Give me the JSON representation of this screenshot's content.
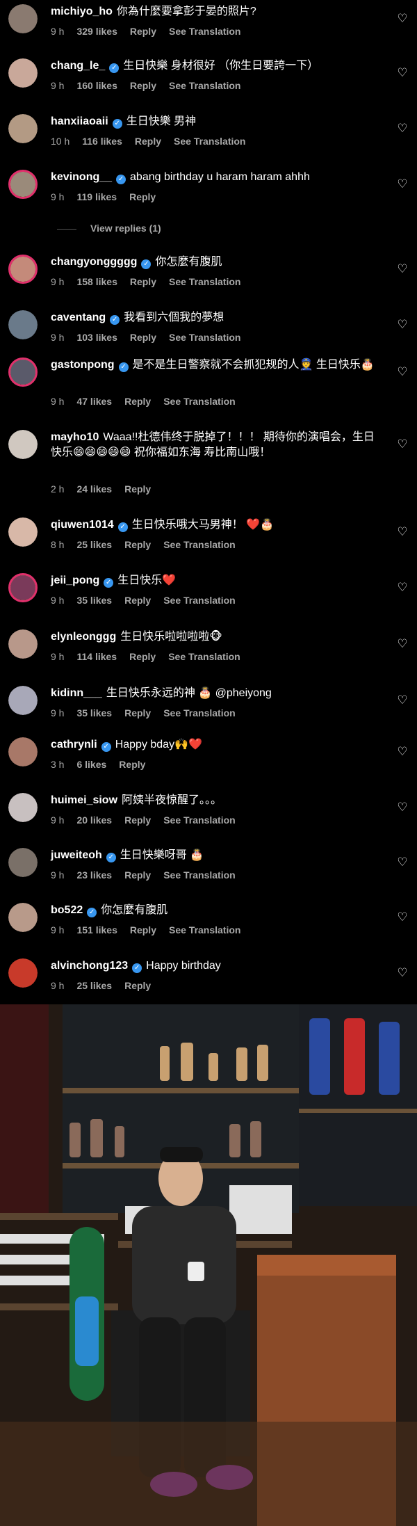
{
  "comments": [
    {
      "username": "michiyo_ho",
      "verified": false,
      "text": "你為什麼要拿彭于晏的照片?",
      "time": "9 h",
      "likes": "329 likes",
      "reply": "Reply",
      "translation": "See Translation",
      "avatar_color": "#8a7a70",
      "ring": false
    },
    {
      "username": "chang_le_",
      "verified": true,
      "text": "生日快樂 身材很好 （你生日要誇一下）",
      "time": "9 h",
      "likes": "160 likes",
      "reply": "Reply",
      "translation": "See Translation",
      "avatar_color": "#c9a89a",
      "ring": false
    },
    {
      "username": "hanxiiaoaii",
      "verified": true,
      "text": "生日快樂 男神",
      "time": "10 h",
      "likes": "116 likes",
      "reply": "Reply",
      "translation": "See Translation",
      "avatar_color": "#b39a84",
      "ring": false
    },
    {
      "username": "kevinong__",
      "verified": true,
      "text": "abang birthday u haram haram ahhh",
      "time": "9 h",
      "likes": "119 likes",
      "reply": "Reply",
      "translation": "",
      "avatar_color": "#9a8a7a",
      "ring": true
    },
    {
      "username": "changyonggggg",
      "verified": true,
      "text": "你怎麼有腹肌",
      "time": "9 h",
      "likes": "158 likes",
      "reply": "Reply",
      "translation": "See Translation",
      "avatar_color": "#c48a7a",
      "ring": true
    },
    {
      "username": "caventang",
      "verified": true,
      "text": "我看到六個我的夢想",
      "time": "9 h",
      "likes": "103 likes",
      "reply": "Reply",
      "translation": "See Translation",
      "avatar_color": "#6a7a8a",
      "ring": false
    },
    {
      "username": "gastonpong",
      "verified": true,
      "text": "是不是生日警察就不会抓犯规的人👮 生日快乐🎂",
      "time": "9 h",
      "likes": "47 likes",
      "reply": "Reply",
      "translation": "See Translation",
      "avatar_color": "#5a5a6a",
      "ring": true
    },
    {
      "username": "mayho10",
      "verified": false,
      "text": "Waaa!!杜德伟终于脱掉了！！！ 期待你的演唱会，生日快乐😄😄😄😄😄 祝你福如东海 寿比南山哦！",
      "time": "2 h",
      "likes": "24 likes",
      "reply": "Reply",
      "translation": "",
      "avatar_color": "#d0c8c0",
      "ring": false
    },
    {
      "username": "qiuwen1014",
      "verified": true,
      "text": "生日快乐哦大马男神！ ❤️🎂",
      "time": "8 h",
      "likes": "25 likes",
      "reply": "Reply",
      "translation": "See Translation",
      "avatar_color": "#d8b8a8",
      "ring": false
    },
    {
      "username": "jeii_pong",
      "verified": true,
      "text": "生日快乐❤️",
      "time": "9 h",
      "likes": "35 likes",
      "reply": "Reply",
      "translation": "See Translation",
      "avatar_color": "#7a3a5a",
      "ring": true
    },
    {
      "username": "elynleonggg",
      "verified": false,
      "text": "生日快乐啦啦啦啦🐵",
      "time": "9 h",
      "likes": "114 likes",
      "reply": "Reply",
      "translation": "See Translation",
      "avatar_color": "#b8988a",
      "ring": false
    },
    {
      "username": "kidinn___",
      "verified": false,
      "text": "生日快乐永远的神 🎂 @pheiyong",
      "time": "9 h",
      "likes": "35 likes",
      "reply": "Reply",
      "translation": "See Translation",
      "avatar_color": "#a8a8b8",
      "ring": false
    },
    {
      "username": "cathrynli",
      "verified": true,
      "text": "Happy bday🙌❤️",
      "time": "3 h",
      "likes": "6 likes",
      "reply": "Reply",
      "translation": "",
      "avatar_color": "#a87868",
      "ring": false
    },
    {
      "username": "huimei_siow",
      "verified": false,
      "text": "阿姨半夜惊醒了。。。",
      "time": "9 h",
      "likes": "20 likes",
      "reply": "Reply",
      "translation": "See Translation",
      "avatar_color": "#c8c0c0",
      "ring": false
    },
    {
      "username": "juweiteoh",
      "verified": true,
      "text": "生日快樂呀哥 🎂",
      "time": "9 h",
      "likes": "23 likes",
      "reply": "Reply",
      "translation": "See Translation",
      "avatar_color": "#7a7068",
      "ring": false
    },
    {
      "username": "bo522",
      "verified": true,
      "text": "你怎麼有腹肌",
      "time": "9 h",
      "likes": "151 likes",
      "reply": "Reply",
      "translation": "See Translation",
      "avatar_color": "#b89a8a",
      "ring": false
    },
    {
      "username": "alvinchong123",
      "verified": true,
      "text": "Happy birthday",
      "time": "9 h",
      "likes": "25 likes",
      "reply": "Reply",
      "translation": "",
      "avatar_color": "#c83a2a",
      "ring": false
    }
  ],
  "view_replies": "View replies (1)",
  "heart_icon": "♡",
  "verified_glyph": "✓"
}
